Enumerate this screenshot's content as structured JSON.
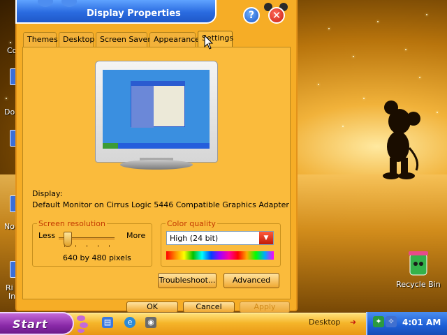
{
  "window": {
    "title": "Display Properties",
    "help_label": "?",
    "close_label": "✕"
  },
  "tabs": [
    {
      "label": "Themes",
      "active": false
    },
    {
      "label": "Desktop",
      "active": false
    },
    {
      "label": "Screen Saver",
      "active": false
    },
    {
      "label": "Appearance",
      "active": false
    },
    {
      "label": "Settings",
      "active": true
    }
  ],
  "settings": {
    "display_label": "Display:",
    "display_value": "Default Monitor on Cirrus Logic 5446 Compatible Graphics Adapter",
    "resolution": {
      "legend": "Screen resolution",
      "less_label": "Less",
      "more_label": "More",
      "value_text": "640 by 480 pixels",
      "slider_position": 0.1
    },
    "color_quality": {
      "legend": "Color quality",
      "selected": "High (24 bit)"
    },
    "troubleshoot_label": "Troubleshoot...",
    "advanced_label": "Advanced"
  },
  "dialog_buttons": {
    "ok": "OK",
    "cancel": "Cancel",
    "apply": "Apply"
  },
  "desktop": {
    "recycle_bin_label": "Recycle Bin",
    "left_fragments": [
      "Co",
      "Do",
      "No",
      "Ri",
      "In"
    ]
  },
  "taskbar": {
    "start_label": "Start",
    "desktop_toolbar_label": "Desktop",
    "clock": "4:01 AM"
  },
  "colors": {
    "window_bg": "#f6ad26",
    "title_blue": "#2a6be0",
    "start_purple": "#8a2aa8",
    "tray_blue": "#1d5ed6"
  }
}
